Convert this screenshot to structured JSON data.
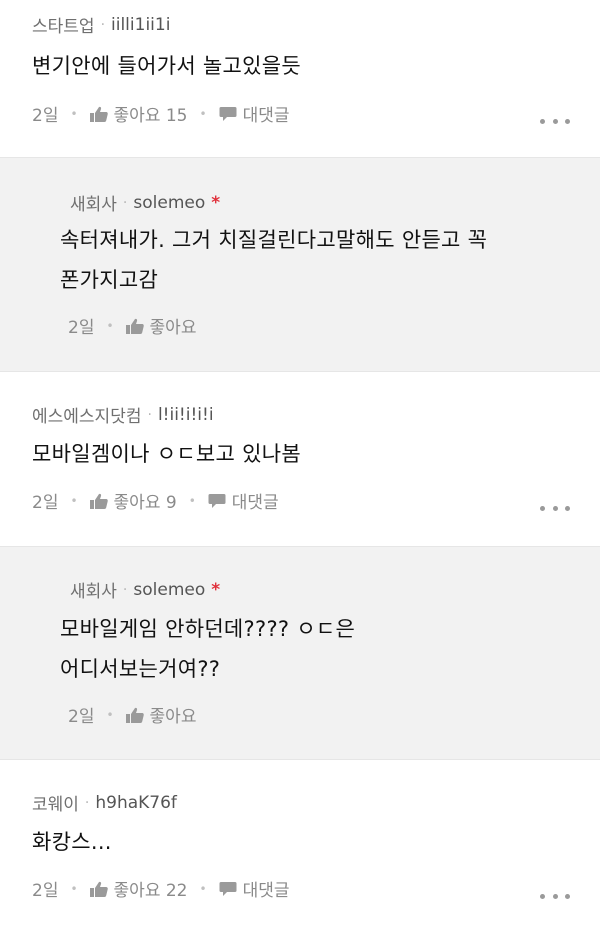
{
  "comments": [
    {
      "board": "스타트업",
      "nick": "iilli1ii1i",
      "text_lines": [
        "변기안에 들어가서 놀고있을듯"
      ],
      "time": "2일",
      "like_label": "좋아요 15",
      "reply_label": "대댓글"
    },
    {
      "board": "새회사",
      "nick": "solemeo",
      "author_mark": "*",
      "text_lines": [
        "속터져내가. 그거 치질걸린다고말해도 안듣고 꼭",
        "폰가지고감"
      ],
      "time": "2일",
      "like_label": "좋아요"
    },
    {
      "board": "에스에스지닷컴",
      "nick": "l!ii!i!i!i",
      "text_lines": [
        "모바일겜이나 ㅇㄷ보고 있나봄"
      ],
      "time": "2일",
      "like_label": "좋아요 9",
      "reply_label": "대댓글"
    },
    {
      "board": "새회사",
      "nick": "solemeo",
      "author_mark": "*",
      "text_lines": [
        "모바일게임 안하던데???? ㅇㄷ은",
        "어디서보는거여??"
      ],
      "time": "2일",
      "like_label": "좋아요"
    },
    {
      "board": "코웨이",
      "nick": "h9haK76f",
      "text_lines": [
        "화캉스..."
      ],
      "time": "2일",
      "like_label": "좋아요 22",
      "reply_label": "대댓글"
    }
  ],
  "icons": {
    "like": "thumbs-up-icon",
    "reply": "speech-bubble-icon",
    "more": "more-dots-icon"
  },
  "colors": {
    "reply_bg": "#f2f2f2",
    "author_mark": "#e0313c"
  }
}
